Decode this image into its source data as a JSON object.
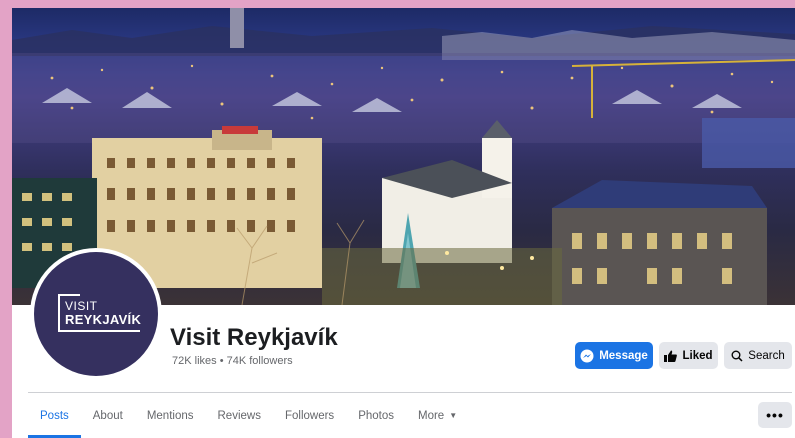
{
  "page": {
    "name": "Visit Reykjavík",
    "stats": "72K likes • 74K followers",
    "avatar": {
      "line1": "VISIT",
      "line2": "REYKJAVÍK"
    }
  },
  "actions": {
    "message": "Message",
    "liked": "Liked",
    "search": "Search"
  },
  "tabs": [
    {
      "label": "Posts",
      "active": true
    },
    {
      "label": "About"
    },
    {
      "label": "Mentions"
    },
    {
      "label": "Reviews"
    },
    {
      "label": "Followers"
    },
    {
      "label": "Photos"
    },
    {
      "label": "More"
    }
  ],
  "more_menu": "•••",
  "colors": {
    "accent": "#1b74e4",
    "avatar_bg": "#35305f",
    "page_bg": "#e3a3c6"
  },
  "icons": [
    "messenger-icon",
    "thumbs-up-icon",
    "search-icon",
    "caret-down-icon",
    "ellipsis-icon"
  ]
}
